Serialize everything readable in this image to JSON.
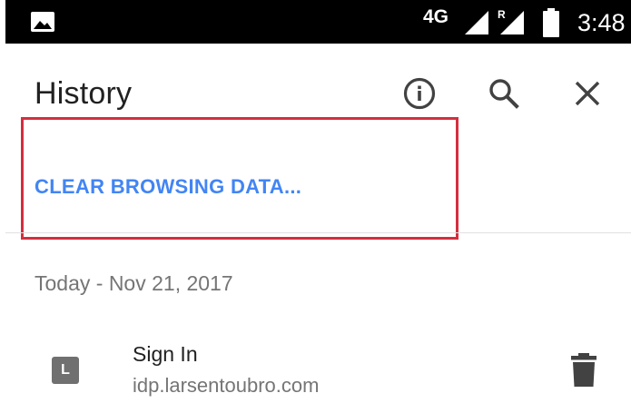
{
  "status_bar": {
    "network_type": "4G",
    "roaming_indicator": "R",
    "time": "3:48",
    "icons": [
      "gallery-icon",
      "signal-icon",
      "signal-roaming-icon",
      "battery-icon"
    ]
  },
  "app_bar": {
    "title": "History",
    "actions": [
      "info-icon",
      "search-icon",
      "close-icon"
    ]
  },
  "clear_data": {
    "label": "CLEAR BROWSING DATA..."
  },
  "history": {
    "date_header": "Today - Nov 21, 2017",
    "items": [
      {
        "favicon_letter": "L",
        "title": "Sign In",
        "url": "idp.larsentoubro.com",
        "action_icon": "trash-icon"
      }
    ]
  },
  "colors": {
    "accent": "#4285f4",
    "highlight": "#d32f3f",
    "status_bar": "#000000",
    "favicon_bg": "#707070"
  }
}
